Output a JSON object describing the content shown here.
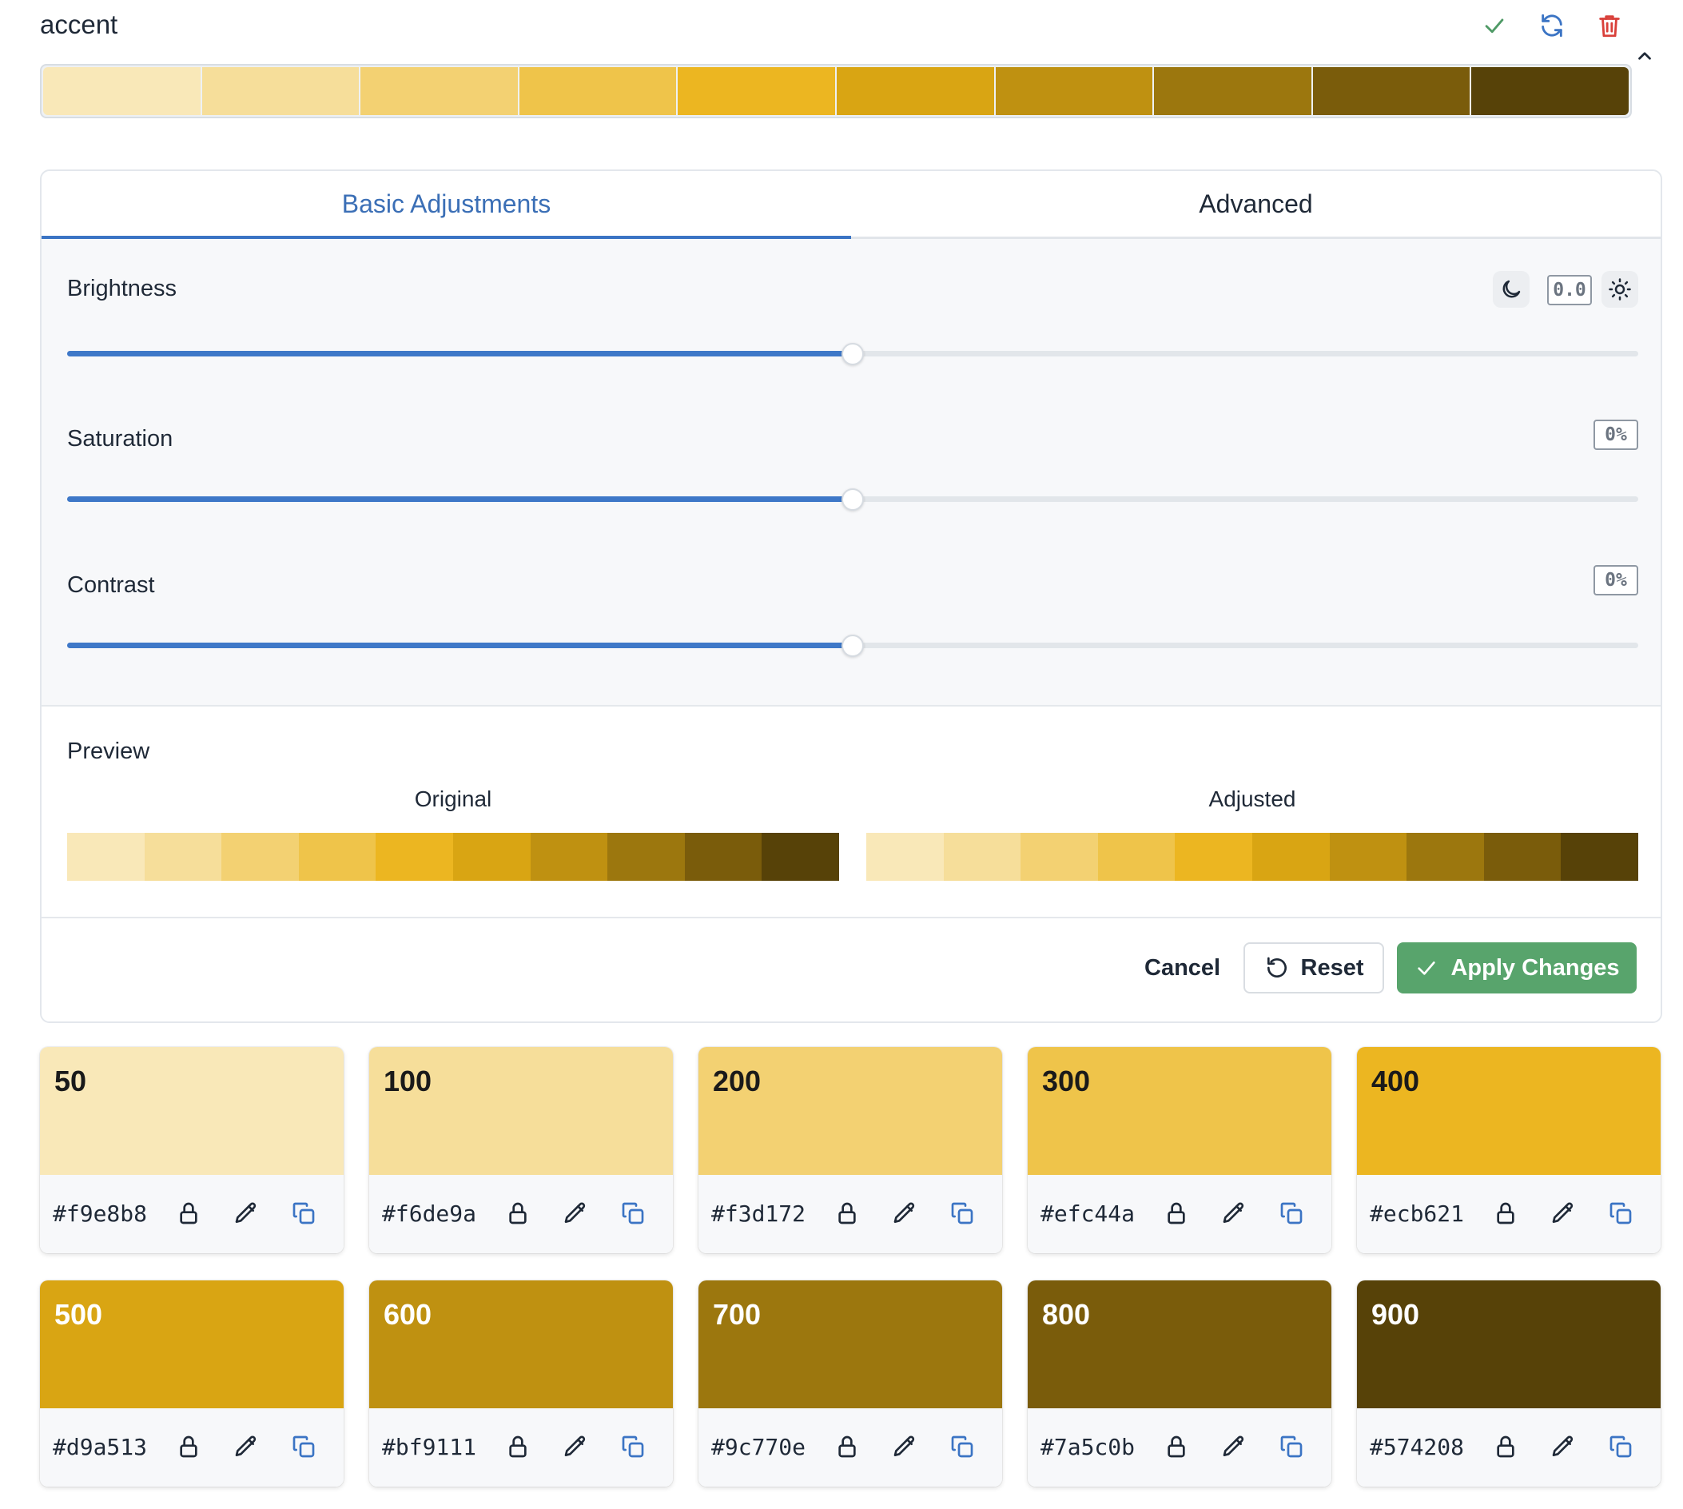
{
  "header": {
    "title": "accent",
    "icons": [
      "check-icon",
      "refresh-icon",
      "trash-icon",
      "chevron-up-icon"
    ]
  },
  "palette": {
    "colors": [
      "#f9e8b8",
      "#f6de9a",
      "#f3d172",
      "#efc44a",
      "#ecb621",
      "#d9a513",
      "#bf9111",
      "#9c770e",
      "#7a5c0b",
      "#574208"
    ]
  },
  "tabs": [
    {
      "label": "Basic Adjustments",
      "active": true
    },
    {
      "label": "Advanced",
      "active": false
    }
  ],
  "adjustments": {
    "brightness": {
      "label": "Brightness",
      "value": "0.0",
      "position": 0.5
    },
    "saturation": {
      "label": "Saturation",
      "value": "0%",
      "position": 0.5
    },
    "contrast": {
      "label": "Contrast",
      "value": "0%",
      "position": 0.5
    }
  },
  "preview": {
    "title": "Preview",
    "original_label": "Original",
    "adjusted_label": "Adjusted"
  },
  "actions": {
    "cancel": "Cancel",
    "reset": "Reset",
    "apply": "Apply Changes"
  },
  "shades": [
    {
      "name": "50",
      "hex": "#f9e8b8",
      "text_color": "#1a1a1a"
    },
    {
      "name": "100",
      "hex": "#f6de9a",
      "text_color": "#1a1a1a"
    },
    {
      "name": "200",
      "hex": "#f3d172",
      "text_color": "#1a1a1a"
    },
    {
      "name": "300",
      "hex": "#efc44a",
      "text_color": "#1a1a1a"
    },
    {
      "name": "400",
      "hex": "#ecb621",
      "text_color": "#1a1a1a"
    },
    {
      "name": "500",
      "hex": "#d9a513",
      "text_color": "#ffffff"
    },
    {
      "name": "600",
      "hex": "#bf9111",
      "text_color": "#ffffff"
    },
    {
      "name": "700",
      "hex": "#9c770e",
      "text_color": "#ffffff"
    },
    {
      "name": "800",
      "hex": "#7a5c0b",
      "text_color": "#ffffff"
    },
    {
      "name": "900",
      "hex": "#574208",
      "text_color": "#ffffff"
    }
  ],
  "colors": {
    "accent": "#3b74c4",
    "success": "#58a46c",
    "danger": "#d9403a",
    "check": "#4f9a66"
  }
}
